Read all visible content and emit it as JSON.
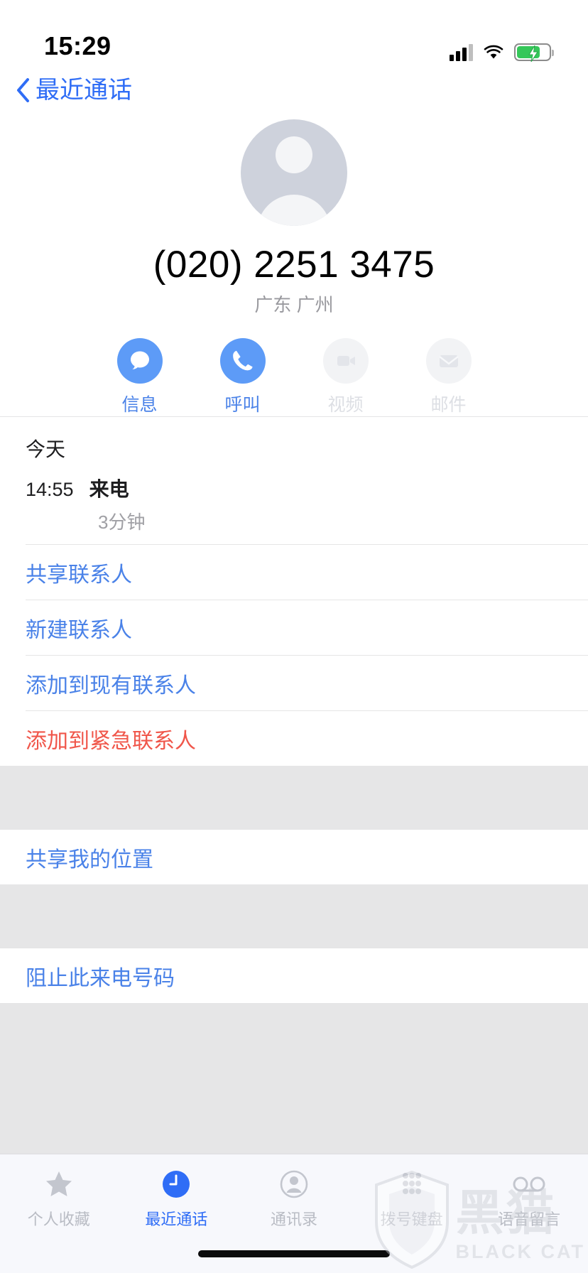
{
  "status_bar": {
    "time": "15:29",
    "signal_icon": "cellular-signal-icon",
    "wifi_icon": "wifi-icon",
    "battery_icon": "battery-charging-icon",
    "battery_color": "#35c759"
  },
  "nav": {
    "back_label": "最近通话",
    "back_icon": "chevron-left-icon",
    "accent": "#2f6df6"
  },
  "contact": {
    "avatar_icon": "default-avatar-icon",
    "phone_number": "(020) 2251 3475",
    "location": "广东 广州"
  },
  "actions": [
    {
      "label": "信息",
      "icon": "message-bubble-icon",
      "enabled": true
    },
    {
      "label": "呼叫",
      "icon": "phone-handset-icon",
      "enabled": true
    },
    {
      "label": "视频",
      "icon": "video-camera-icon",
      "enabled": false
    },
    {
      "label": "邮件",
      "icon": "mail-envelope-icon",
      "enabled": false
    }
  ],
  "history": {
    "day_label": "今天",
    "entries": [
      {
        "time": "14:55",
        "type": "来电",
        "duration": "3分钟"
      }
    ]
  },
  "menu_group_1": [
    {
      "label": "共享联系人",
      "style": "normal"
    },
    {
      "label": "新建联系人",
      "style": "normal"
    },
    {
      "label": "添加到现有联系人",
      "style": "normal"
    },
    {
      "label": "添加到紧急联系人",
      "style": "danger"
    }
  ],
  "menu_group_2": [
    {
      "label": "共享我的位置",
      "style": "normal"
    }
  ],
  "menu_group_3": [
    {
      "label": "阻止此来电号码",
      "style": "normal"
    }
  ],
  "tabbar": [
    {
      "label": "个人收藏",
      "icon": "star-icon",
      "active": false
    },
    {
      "label": "最近通话",
      "icon": "recents-clock-icon",
      "active": true
    },
    {
      "label": "通讯录",
      "icon": "contacts-person-icon",
      "active": false
    },
    {
      "label": "拨号键盘",
      "icon": "keypad-dots-icon",
      "active": false
    },
    {
      "label": "语音留言",
      "icon": "voicemail-icon",
      "active": false
    }
  ],
  "watermark": {
    "shield_icon": "black-cat-shield-icon",
    "cn_text": "黑猫",
    "en_text": "BLACK CAT"
  },
  "colors": {
    "accent_blue": "#2f6df6",
    "action_blue": "#5d9bf7",
    "danger_red": "#f0564a",
    "muted_gray": "#9a9a9f",
    "group_bg": "#e6e6e7"
  }
}
